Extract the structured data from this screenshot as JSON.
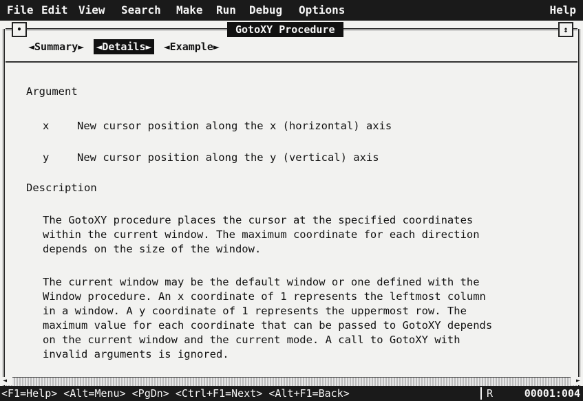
{
  "menu": {
    "items": [
      "File",
      "Edit",
      "View",
      "Search",
      "Make",
      "Run",
      "Debug",
      "Options"
    ],
    "help": "Help"
  },
  "window": {
    "title": "GotoXY Procedure",
    "close_glyph": "•",
    "zoom_glyph": "↕"
  },
  "tabs": [
    {
      "label": "◄Summary►",
      "active": false
    },
    {
      "label": "◄Details►",
      "active": true
    },
    {
      "label": "◄Example►",
      "active": false
    }
  ],
  "content": {
    "argument_heading": "Argument",
    "arguments": [
      {
        "name": "x",
        "desc": "New cursor position along the x (horizontal) axis"
      },
      {
        "name": "y",
        "desc": "New cursor position along the y (vertical) axis"
      }
    ],
    "description_heading": "Description",
    "paragraph1": "The GotoXY procedure places the cursor at the specified coordinates\nwithin the current window. The maximum coordinate for each direction\ndepends on the size of the window.",
    "paragraph2": "The current window may be the default window or one defined with the\nWindow procedure. An x coordinate of 1 represents the leftmost column\nin a window. A y coordinate of 1 represents the uppermost row. The\nmaximum value for each coordinate that can be passed to GotoXY depends\non the current window and the current mode. A call to GotoXY with\ninvalid arguments is ignored."
  },
  "status": {
    "keys": "<F1=Help> <Alt=Menu> <PgDn> <Ctrl+F1=Next> <Alt+F1=Back>",
    "mode": "R",
    "position": "00001:004"
  }
}
